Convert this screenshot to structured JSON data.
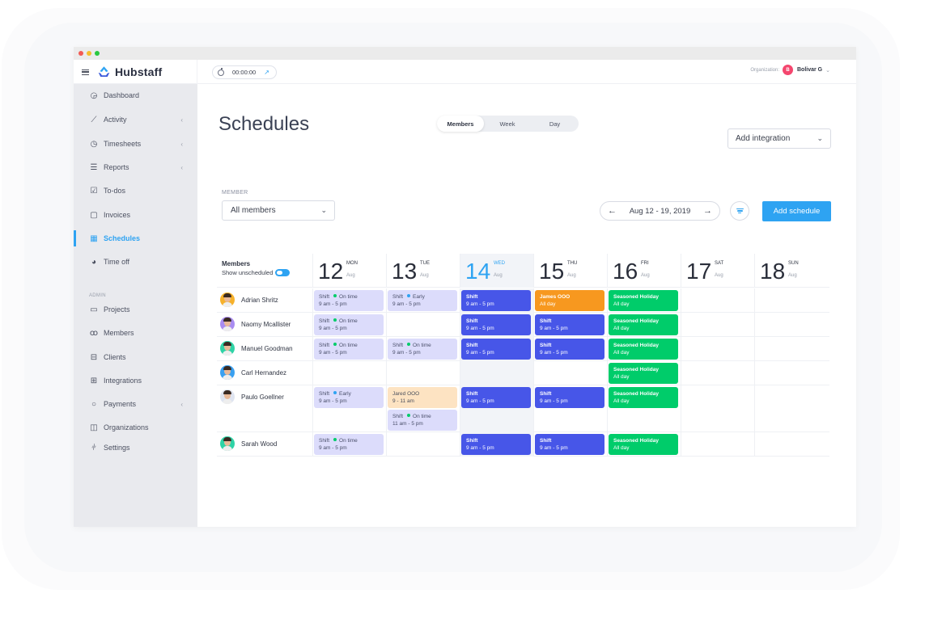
{
  "window": {
    "traffic_lights": [
      "#f25a54",
      "#f6be2c",
      "#2ac840"
    ]
  },
  "topbar": {
    "brand": "Hubstaff",
    "timer": "00:00:00",
    "org_label": "Organization:",
    "org_initial": "B",
    "user_name": "Bolivar G"
  },
  "sidebar": {
    "items": [
      {
        "label": "Dashboard",
        "icon": "gauge-icon",
        "glyph": "◶",
        "caret": false
      },
      {
        "label": "Activity",
        "icon": "chart-line-icon",
        "glyph": "⟋",
        "caret": true
      },
      {
        "label": "Timesheets",
        "icon": "clock-icon",
        "glyph": "◷",
        "caret": true
      },
      {
        "label": "Reports",
        "icon": "report-icon",
        "glyph": "☰",
        "caret": true
      },
      {
        "label": "To-dos",
        "icon": "checkbox-icon",
        "glyph": "☑",
        "caret": false
      },
      {
        "label": "Invoices",
        "icon": "invoice-icon",
        "glyph": "▢",
        "caret": false
      },
      {
        "label": "Schedules",
        "icon": "calendar-icon",
        "glyph": "▦",
        "caret": false,
        "active": true
      },
      {
        "label": "Time off",
        "icon": "pie-icon",
        "glyph": "◕",
        "caret": false
      }
    ],
    "admin_label": "ADMIN",
    "admin_items": [
      {
        "label": "Projects",
        "icon": "folder-icon",
        "glyph": "▭",
        "caret": false
      },
      {
        "label": "Members",
        "icon": "members-icon",
        "glyph": "ꝏ",
        "caret": false
      },
      {
        "label": "Clients",
        "icon": "briefcase-icon",
        "glyph": "⊟",
        "caret": false
      },
      {
        "label": "Integrations",
        "icon": "integrations-icon",
        "glyph": "⊞",
        "caret": false
      },
      {
        "label": "Payments",
        "icon": "payments-icon",
        "glyph": "○",
        "caret": true
      },
      {
        "label": "Organizations",
        "icon": "building-icon",
        "glyph": "◫",
        "caret": false
      },
      {
        "label": "Settings",
        "icon": "sliders-icon",
        "glyph": "⫩",
        "caret": false
      }
    ],
    "accent": "#2ea3f2"
  },
  "main": {
    "title": "Schedules",
    "view_tabs": [
      {
        "label": "Members",
        "active": true
      },
      {
        "label": "Week",
        "active": false
      },
      {
        "label": "Day",
        "active": false
      }
    ],
    "integration_select": "Add integration",
    "member_label": "MEMBER",
    "member_select": "All members",
    "date_range": "Aug 12 - 19, 2019",
    "add_schedule": "Add schedule"
  },
  "grid": {
    "members_header": "Members",
    "show_unscheduled": "Show unscheduled",
    "show_unscheduled_on": true,
    "days": [
      {
        "num": "12",
        "name": "MON",
        "month": "Aug",
        "today": false
      },
      {
        "num": "13",
        "name": "TUE",
        "month": "Aug",
        "today": false
      },
      {
        "num": "14",
        "name": "WED",
        "month": "Aug",
        "today": true
      },
      {
        "num": "15",
        "name": "THU",
        "month": "Aug",
        "today": false
      },
      {
        "num": "16",
        "name": "FRI",
        "month": "Aug",
        "today": false
      },
      {
        "num": "17",
        "name": "SAT",
        "month": "Aug",
        "today": false
      },
      {
        "num": "18",
        "name": "SUN",
        "month": "Aug",
        "today": false
      }
    ],
    "status_colors": {
      "On time": "#00cc6a",
      "Early": "#2ea3f2"
    },
    "rows": [
      {
        "name": "Adrian Shritz",
        "avatar_bg": "#f6b12b",
        "lines": 1,
        "events": [
          {
            "day": 0,
            "slot": 0,
            "type": "light",
            "title": "Shift",
            "status": "On time",
            "time": "9 am - 5 pm"
          },
          {
            "day": 1,
            "slot": 0,
            "type": "light",
            "title": "Shift",
            "status": "Early",
            "time": "9 am - 5 pm"
          },
          {
            "day": 2,
            "slot": 0,
            "type": "blue",
            "title": "Shift",
            "time": "9 am - 5 pm"
          },
          {
            "day": 3,
            "slot": 0,
            "type": "orange",
            "title": "James OOO",
            "time": "All day"
          },
          {
            "day": 4,
            "slot": 0,
            "type": "green",
            "title": "Seasoned Holiday",
            "time": "All day"
          }
        ]
      },
      {
        "name": "Naomy Mcallister",
        "avatar_bg": "#a98cf0",
        "lines": 1,
        "events": [
          {
            "day": 0,
            "slot": 0,
            "type": "light",
            "title": "Shift",
            "status": "On time",
            "time": "9 am - 5 pm"
          },
          {
            "day": 2,
            "slot": 0,
            "type": "blue",
            "title": "Shift",
            "time": "9 am - 5 pm"
          },
          {
            "day": 3,
            "slot": 0,
            "type": "blue",
            "title": "Shift",
            "time": "9 am - 5 pm"
          },
          {
            "day": 4,
            "slot": 0,
            "type": "green",
            "title": "Seasoned Holiday",
            "time": "All day"
          }
        ]
      },
      {
        "name": "Manuel Goodman",
        "avatar_bg": "#2ed3a6",
        "lines": 1,
        "events": [
          {
            "day": 0,
            "slot": 0,
            "type": "light",
            "title": "Shift",
            "status": "On time",
            "time": "9 am - 5 pm"
          },
          {
            "day": 1,
            "slot": 0,
            "type": "light",
            "title": "Shift",
            "status": "On time",
            "time": "9 am - 5 pm"
          },
          {
            "day": 2,
            "slot": 0,
            "type": "blue",
            "title": "Shift",
            "time": "9 am - 5 pm"
          },
          {
            "day": 3,
            "slot": 0,
            "type": "blue",
            "title": "Shift",
            "time": "9 am - 5 pm"
          },
          {
            "day": 4,
            "slot": 0,
            "type": "green",
            "title": "Seasoned Holiday",
            "time": "All day"
          }
        ]
      },
      {
        "name": "Carl Hernandez",
        "avatar_bg": "#3aa0f0",
        "lines": 1,
        "events": [
          {
            "day": 4,
            "slot": 0,
            "type": "green",
            "title": "Seasoned Holiday",
            "time": "All day"
          }
        ]
      },
      {
        "name": "Paulo Goellner",
        "avatar_bg": "#dfe4f0",
        "lines": 2,
        "events": [
          {
            "day": 0,
            "slot": 0,
            "type": "light",
            "title": "Shift",
            "status": "Early",
            "time": "9 am - 5 pm"
          },
          {
            "day": 1,
            "slot": 0,
            "type": "peach",
            "title": "Jared OOO",
            "time": "9 - 11 am"
          },
          {
            "day": 1,
            "slot": 1,
            "type": "light",
            "title": "Shift",
            "status": "On time",
            "time": "11 am - 5 pm"
          },
          {
            "day": 2,
            "slot": 0,
            "type": "blue",
            "title": "Shift",
            "time": "9 am - 5 pm"
          },
          {
            "day": 3,
            "slot": 0,
            "type": "blue",
            "title": "Shift",
            "time": "9 am - 5 pm"
          },
          {
            "day": 4,
            "slot": 0,
            "type": "green",
            "title": "Seasoned Holiday",
            "time": "All day"
          }
        ]
      },
      {
        "name": "Sarah Wood",
        "avatar_bg": "#2ed3a6",
        "lines": 1,
        "events": [
          {
            "day": 0,
            "slot": 0,
            "type": "light",
            "title": "Shift",
            "status": "On time",
            "time": "9 am - 5 pm"
          },
          {
            "day": 2,
            "slot": 0,
            "type": "blue",
            "title": "Shift",
            "time": "9 am - 5 pm"
          },
          {
            "day": 3,
            "slot": 0,
            "type": "blue",
            "title": "Shift",
            "time": "9 am - 5 pm"
          },
          {
            "day": 4,
            "slot": 0,
            "type": "green",
            "title": "Seasoned Holiday",
            "time": "All day"
          }
        ]
      }
    ]
  }
}
